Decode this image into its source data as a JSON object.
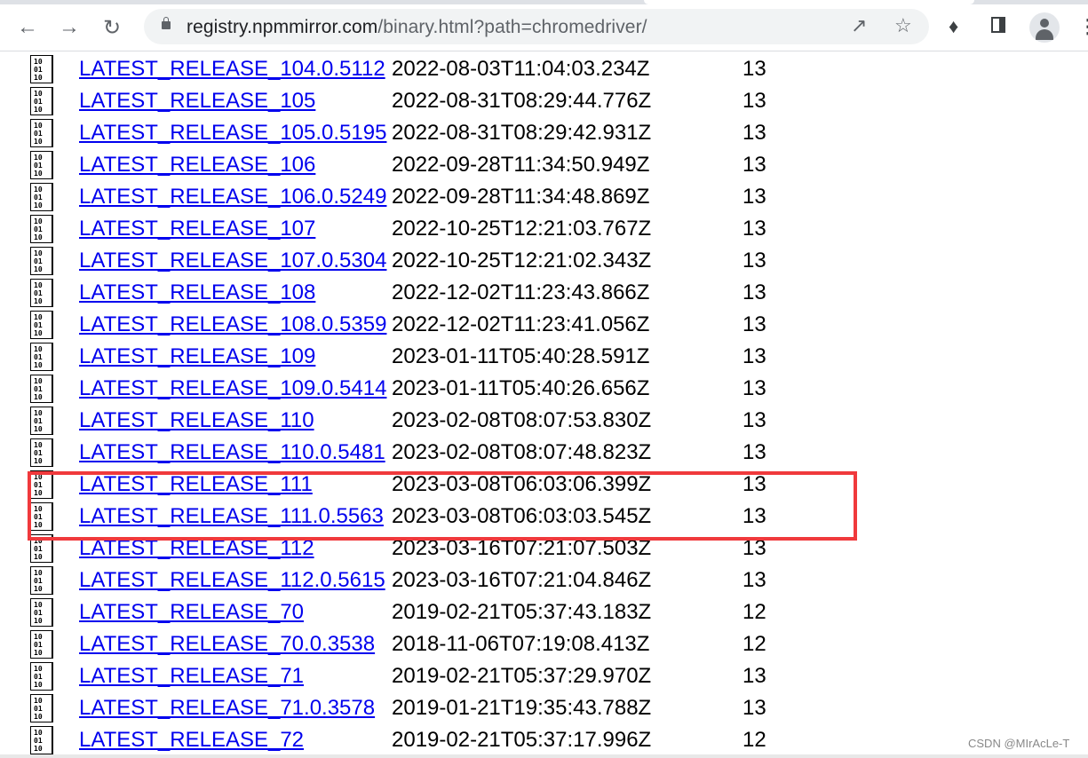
{
  "browser": {
    "url_host": "registry.npmmirror.com",
    "url_rest": "/binary.html?path=chromedriver/",
    "icons": [
      "back-icon",
      "forward-icon",
      "reload-icon",
      "lock-icon",
      "share-icon",
      "star-icon",
      "extensions-icon",
      "side-panel-icon",
      "profile-icon",
      "menu-icon"
    ]
  },
  "files": [
    {
      "name": "LATEST_RELEASE_104.0.5112",
      "date": "2022-08-03T11:04:03.234Z",
      "size": "13"
    },
    {
      "name": "LATEST_RELEASE_105",
      "date": "2022-08-31T08:29:44.776Z",
      "size": "13"
    },
    {
      "name": "LATEST_RELEASE_105.0.5195",
      "date": "2022-08-31T08:29:42.931Z",
      "size": "13"
    },
    {
      "name": "LATEST_RELEASE_106",
      "date": "2022-09-28T11:34:50.949Z",
      "size": "13"
    },
    {
      "name": "LATEST_RELEASE_106.0.5249",
      "date": "2022-09-28T11:34:48.869Z",
      "size": "13"
    },
    {
      "name": "LATEST_RELEASE_107",
      "date": "2022-10-25T12:21:03.767Z",
      "size": "13"
    },
    {
      "name": "LATEST_RELEASE_107.0.5304",
      "date": "2022-10-25T12:21:02.343Z",
      "size": "13"
    },
    {
      "name": "LATEST_RELEASE_108",
      "date": "2022-12-02T11:23:43.866Z",
      "size": "13"
    },
    {
      "name": "LATEST_RELEASE_108.0.5359",
      "date": "2022-12-02T11:23:41.056Z",
      "size": "13"
    },
    {
      "name": "LATEST_RELEASE_109",
      "date": "2023-01-11T05:40:28.591Z",
      "size": "13"
    },
    {
      "name": "LATEST_RELEASE_109.0.5414",
      "date": "2023-01-11T05:40:26.656Z",
      "size": "13"
    },
    {
      "name": "LATEST_RELEASE_110",
      "date": "2023-02-08T08:07:53.830Z",
      "size": "13"
    },
    {
      "name": "LATEST_RELEASE_110.0.5481",
      "date": "2023-02-08T08:07:48.823Z",
      "size": "13"
    },
    {
      "name": "LATEST_RELEASE_111",
      "date": "2023-03-08T06:03:06.399Z",
      "size": "13"
    },
    {
      "name": "LATEST_RELEASE_111.0.5563",
      "date": "2023-03-08T06:03:03.545Z",
      "size": "13"
    },
    {
      "name": "LATEST_RELEASE_112",
      "date": "2023-03-16T07:21:07.503Z",
      "size": "13"
    },
    {
      "name": "LATEST_RELEASE_112.0.5615",
      "date": "2023-03-16T07:21:04.846Z",
      "size": "13"
    },
    {
      "name": "LATEST_RELEASE_70",
      "date": "2019-02-21T05:37:43.183Z",
      "size": "12"
    },
    {
      "name": "LATEST_RELEASE_70.0.3538",
      "date": "2018-11-06T07:19:08.413Z",
      "size": "12"
    },
    {
      "name": "LATEST_RELEASE_71",
      "date": "2019-02-21T05:37:29.970Z",
      "size": "13"
    },
    {
      "name": "LATEST_RELEASE_71.0.3578",
      "date": "2019-01-21T19:35:43.788Z",
      "size": "13"
    },
    {
      "name": "LATEST_RELEASE_72",
      "date": "2019-02-21T05:37:17.996Z",
      "size": "12"
    }
  ],
  "file_icon_text": "10 01 10",
  "highlight_color": "#f0393c",
  "link_color": "#0000ee",
  "watermark": "CSDN @MIrAcLe-T"
}
